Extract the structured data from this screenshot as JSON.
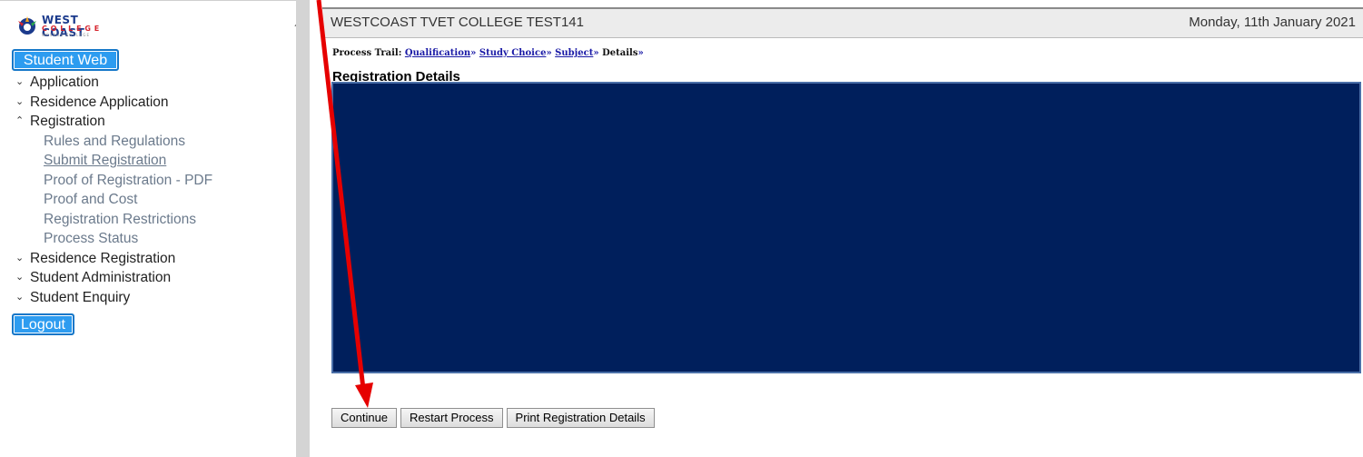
{
  "logo": {
    "line1": "WEST COAST",
    "line2": "COLLEGE",
    "line3": "WESKUS KOLLEGE"
  },
  "sidebar": {
    "student_web_label": "Student Web",
    "logout_label": "Logout",
    "items": [
      {
        "label": "Application",
        "state": "collapsed"
      },
      {
        "label": "Residence Application",
        "state": "collapsed"
      },
      {
        "label": "Registration",
        "state": "expanded",
        "children": [
          "Rules and Regulations",
          "Submit Registration",
          "Proof of Registration - PDF",
          "Proof and Cost",
          "Registration Restrictions",
          "Process Status"
        ]
      },
      {
        "label": "Residence Registration",
        "state": "collapsed"
      },
      {
        "label": "Student Administration",
        "state": "collapsed"
      },
      {
        "label": "Student Enquiry",
        "state": "collapsed"
      }
    ]
  },
  "header": {
    "title": "WESTCOAST TVET COLLEGE TEST141",
    "date": "Monday, 11th January 2021"
  },
  "trail": {
    "prefix": "Process Trail:",
    "steps": [
      "Qualification",
      "Study Choice",
      "Subject",
      "Details"
    ],
    "separator": "»"
  },
  "main": {
    "heading": "Registration Details"
  },
  "buttons": {
    "continue": "Continue",
    "restart": "Restart Process",
    "print": "Print Registration Details"
  },
  "colors": {
    "panel": "#001f5c",
    "accent": "#2d9cf0",
    "arrow": "#e60000"
  },
  "icons": {
    "expand": "chevron-down-icon",
    "collapse": "chevron-up-icon"
  }
}
